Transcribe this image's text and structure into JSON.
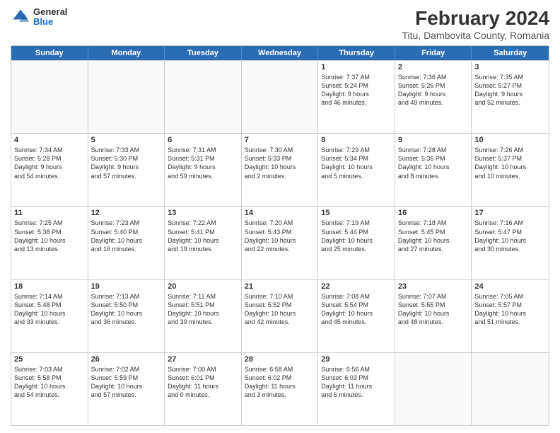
{
  "logo": {
    "general": "General",
    "blue": "Blue"
  },
  "header": {
    "title": "February 2024",
    "subtitle": "Titu, Dambovita County, Romania"
  },
  "weekdays": [
    "Sunday",
    "Monday",
    "Tuesday",
    "Wednesday",
    "Thursday",
    "Friday",
    "Saturday"
  ],
  "rows": [
    [
      {
        "day": "",
        "info": "",
        "empty": true
      },
      {
        "day": "",
        "info": "",
        "empty": true
      },
      {
        "day": "",
        "info": "",
        "empty": true
      },
      {
        "day": "",
        "info": "",
        "empty": true
      },
      {
        "day": "1",
        "info": "Sunrise: 7:37 AM\nSunset: 5:24 PM\nDaylight: 9 hours\nand 46 minutes.",
        "empty": false
      },
      {
        "day": "2",
        "info": "Sunrise: 7:36 AM\nSunset: 5:26 PM\nDaylight: 9 hours\nand 49 minutes.",
        "empty": false
      },
      {
        "day": "3",
        "info": "Sunrise: 7:35 AM\nSunset: 5:27 PM\nDaylight: 9 hours\nand 52 minutes.",
        "empty": false
      }
    ],
    [
      {
        "day": "4",
        "info": "Sunrise: 7:34 AM\nSunset: 5:28 PM\nDaylight: 9 hours\nand 54 minutes.",
        "empty": false
      },
      {
        "day": "5",
        "info": "Sunrise: 7:33 AM\nSunset: 5:30 PM\nDaylight: 9 hours\nand 57 minutes.",
        "empty": false
      },
      {
        "day": "6",
        "info": "Sunrise: 7:31 AM\nSunset: 5:31 PM\nDaylight: 9 hours\nand 59 minutes.",
        "empty": false
      },
      {
        "day": "7",
        "info": "Sunrise: 7:30 AM\nSunset: 5:33 PM\nDaylight: 10 hours\nand 2 minutes.",
        "empty": false
      },
      {
        "day": "8",
        "info": "Sunrise: 7:29 AM\nSunset: 5:34 PM\nDaylight: 10 hours\nand 5 minutes.",
        "empty": false
      },
      {
        "day": "9",
        "info": "Sunrise: 7:28 AM\nSunset: 5:36 PM\nDaylight: 10 hours\nand 8 minutes.",
        "empty": false
      },
      {
        "day": "10",
        "info": "Sunrise: 7:26 AM\nSunset: 5:37 PM\nDaylight: 10 hours\nand 10 minutes.",
        "empty": false
      }
    ],
    [
      {
        "day": "11",
        "info": "Sunrise: 7:25 AM\nSunset: 5:38 PM\nDaylight: 10 hours\nand 13 minutes.",
        "empty": false
      },
      {
        "day": "12",
        "info": "Sunrise: 7:23 AM\nSunset: 5:40 PM\nDaylight: 10 hours\nand 16 minutes.",
        "empty": false
      },
      {
        "day": "13",
        "info": "Sunrise: 7:22 AM\nSunset: 5:41 PM\nDaylight: 10 hours\nand 19 minutes.",
        "empty": false
      },
      {
        "day": "14",
        "info": "Sunrise: 7:20 AM\nSunset: 5:43 PM\nDaylight: 10 hours\nand 22 minutes.",
        "empty": false
      },
      {
        "day": "15",
        "info": "Sunrise: 7:19 AM\nSunset: 5:44 PM\nDaylight: 10 hours\nand 25 minutes.",
        "empty": false
      },
      {
        "day": "16",
        "info": "Sunrise: 7:18 AM\nSunset: 5:45 PM\nDaylight: 10 hours\nand 27 minutes.",
        "empty": false
      },
      {
        "day": "17",
        "info": "Sunrise: 7:16 AM\nSunset: 5:47 PM\nDaylight: 10 hours\nand 30 minutes.",
        "empty": false
      }
    ],
    [
      {
        "day": "18",
        "info": "Sunrise: 7:14 AM\nSunset: 5:48 PM\nDaylight: 10 hours\nand 33 minutes.",
        "empty": false
      },
      {
        "day": "19",
        "info": "Sunrise: 7:13 AM\nSunset: 5:50 PM\nDaylight: 10 hours\nand 36 minutes.",
        "empty": false
      },
      {
        "day": "20",
        "info": "Sunrise: 7:11 AM\nSunset: 5:51 PM\nDaylight: 10 hours\nand 39 minutes.",
        "empty": false
      },
      {
        "day": "21",
        "info": "Sunrise: 7:10 AM\nSunset: 5:52 PM\nDaylight: 10 hours\nand 42 minutes.",
        "empty": false
      },
      {
        "day": "22",
        "info": "Sunrise: 7:08 AM\nSunset: 5:54 PM\nDaylight: 10 hours\nand 45 minutes.",
        "empty": false
      },
      {
        "day": "23",
        "info": "Sunrise: 7:07 AM\nSunset: 5:55 PM\nDaylight: 10 hours\nand 48 minutes.",
        "empty": false
      },
      {
        "day": "24",
        "info": "Sunrise: 7:05 AM\nSunset: 5:57 PM\nDaylight: 10 hours\nand 51 minutes.",
        "empty": false
      }
    ],
    [
      {
        "day": "25",
        "info": "Sunrise: 7:03 AM\nSunset: 5:58 PM\nDaylight: 10 hours\nand 54 minutes.",
        "empty": false
      },
      {
        "day": "26",
        "info": "Sunrise: 7:02 AM\nSunset: 5:59 PM\nDaylight: 10 hours\nand 57 minutes.",
        "empty": false
      },
      {
        "day": "27",
        "info": "Sunrise: 7:00 AM\nSunset: 6:01 PM\nDaylight: 11 hours\nand 0 minutes.",
        "empty": false
      },
      {
        "day": "28",
        "info": "Sunrise: 6:58 AM\nSunset: 6:02 PM\nDaylight: 11 hours\nand 3 minutes.",
        "empty": false
      },
      {
        "day": "29",
        "info": "Sunrise: 6:56 AM\nSunset: 6:03 PM\nDaylight: 11 hours\nand 6 minutes.",
        "empty": false
      },
      {
        "day": "",
        "info": "",
        "empty": true
      },
      {
        "day": "",
        "info": "",
        "empty": true
      }
    ]
  ]
}
